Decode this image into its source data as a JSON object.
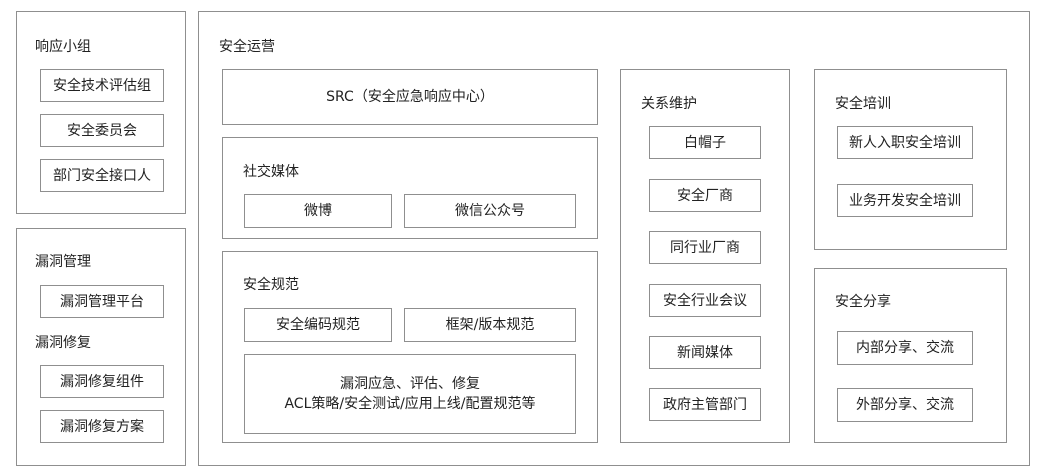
{
  "response_team": {
    "title": "响应小组",
    "items": [
      "安全技术评估组",
      "安全委员会",
      "部门安全接口人"
    ]
  },
  "vuln": {
    "mgmt_title": "漏洞管理",
    "mgmt_item": "漏洞管理平台",
    "fix_title": "漏洞修复",
    "fix_items": [
      "漏洞修复组件",
      "漏洞修复方案"
    ]
  },
  "operations": {
    "title": "安全运营",
    "src": "SRC（安全应急响应中心）",
    "social": {
      "title": "社交媒体",
      "items": [
        "微博",
        "微信公众号"
      ]
    },
    "standards": {
      "title": "安全规范",
      "items": [
        "安全编码规范",
        "框架/版本规范"
      ],
      "detail_line1": "漏洞应急、评估、修复",
      "detail_line2": "ACL策略/安全测试/应用上线/配置规范等"
    },
    "relations": {
      "title": "关系维护",
      "items": [
        "白帽子",
        "安全厂商",
        "同行业厂商",
        "安全行业会议",
        "新闻媒体",
        "政府主管部门"
      ]
    },
    "training": {
      "title": "安全培训",
      "items": [
        "新人入职安全培训",
        "业务开发安全培训"
      ]
    },
    "sharing": {
      "title": "安全分享",
      "items": [
        "内部分享、交流",
        "外部分享、交流"
      ]
    }
  }
}
